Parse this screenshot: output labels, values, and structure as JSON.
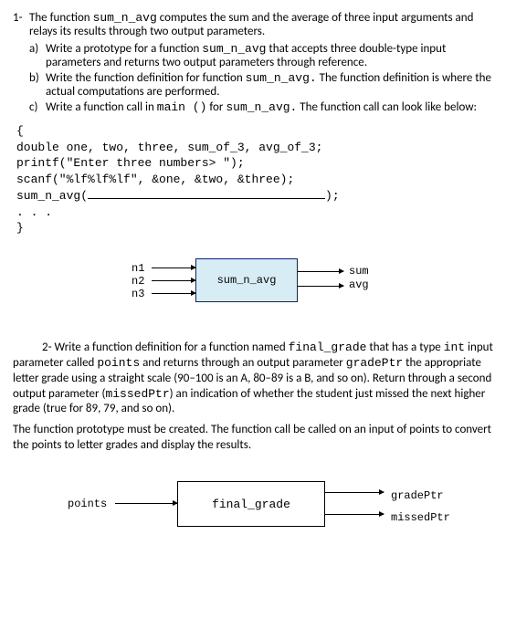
{
  "q1": {
    "number": "1-",
    "intro1": "The function ",
    "intro_code": "sum_n_avg",
    "intro2": " computes the sum and the average of three input arguments and relays its results through two output parameters.",
    "a": {
      "letter": "a)",
      "t1": "Write a prototype for a function ",
      "c1": "sum_n_avg",
      "t2": " that accepts three double-type input parameters and returns two output parameters through reference."
    },
    "b": {
      "letter": "b)",
      "t1": "Write the function definition for function ",
      "c1": "sum_n_avg.",
      "t2": " The function definition is where the actual computations are performed."
    },
    "c": {
      "letter": "c)",
      "t1": "Write a function call in ",
      "c1": "main ()",
      "t2": " for ",
      "c2": "sum_n_avg.",
      "t3": " The function call can look like below:"
    }
  },
  "code": {
    "l1": "{",
    "l2": "double one, two, three, sum_of_3, avg_of_3;",
    "l3": "printf(\"Enter three numbers> \");",
    "l4": "scanf(\"%lf%lf%lf\", &one, &two, &three);",
    "l5a": "sum_n_avg(",
    "l5b": ");",
    "l6": ". . .",
    "l7": "}"
  },
  "dg1": {
    "in": [
      "n1",
      "n2",
      "n3"
    ],
    "box": "sum_n_avg",
    "out": [
      "sum",
      "avg"
    ]
  },
  "q2": {
    "p1": {
      "lead": "2- ",
      "t1": "Write a function definition for a function named ",
      "c1": "final_grade",
      "t2": " that has a type ",
      "c2": "int",
      "t3": " input parameter called ",
      "c3": "points",
      "t4": " and returns through an output parameter ",
      "c4": "gradePtr",
      "t5": " the appropriate letter grade using a straight scale (90–100 is an A, 80–89 is a B, and so on). Return through a second output parameter (",
      "c5": "missedPtr",
      "t6": ") an indication of whether the student just missed the next higher grade (true for 89, 79, and so on)."
    },
    "p2": "The function prototype must be created. The function call be called on an input of points to convert the points to letter grades and display the results."
  },
  "dg2": {
    "in": "points",
    "box": "final_grade",
    "out": [
      "gradePtr",
      "missedPtr"
    ]
  }
}
